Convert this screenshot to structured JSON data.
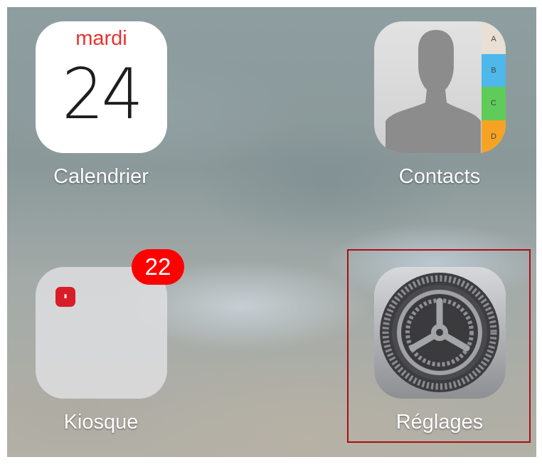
{
  "apps": {
    "calendar": {
      "label": "Calendrier",
      "day": "mardi",
      "date": "24",
      "icon": "calendar-icon"
    },
    "contacts": {
      "label": "Contacts",
      "icon": "contacts-icon",
      "tabs": [
        "A",
        "B",
        "C",
        "D"
      ]
    },
    "kiosque": {
      "label": "Kiosque",
      "icon": "newsstand-folder-icon",
      "badge": "22"
    },
    "settings": {
      "label": "Réglages",
      "icon": "gear-icon"
    }
  },
  "colors": {
    "badge": "#fe0000",
    "calendar_day": "#e8322f",
    "highlight": "#a70f14"
  },
  "highlight": {
    "target": "settings"
  }
}
